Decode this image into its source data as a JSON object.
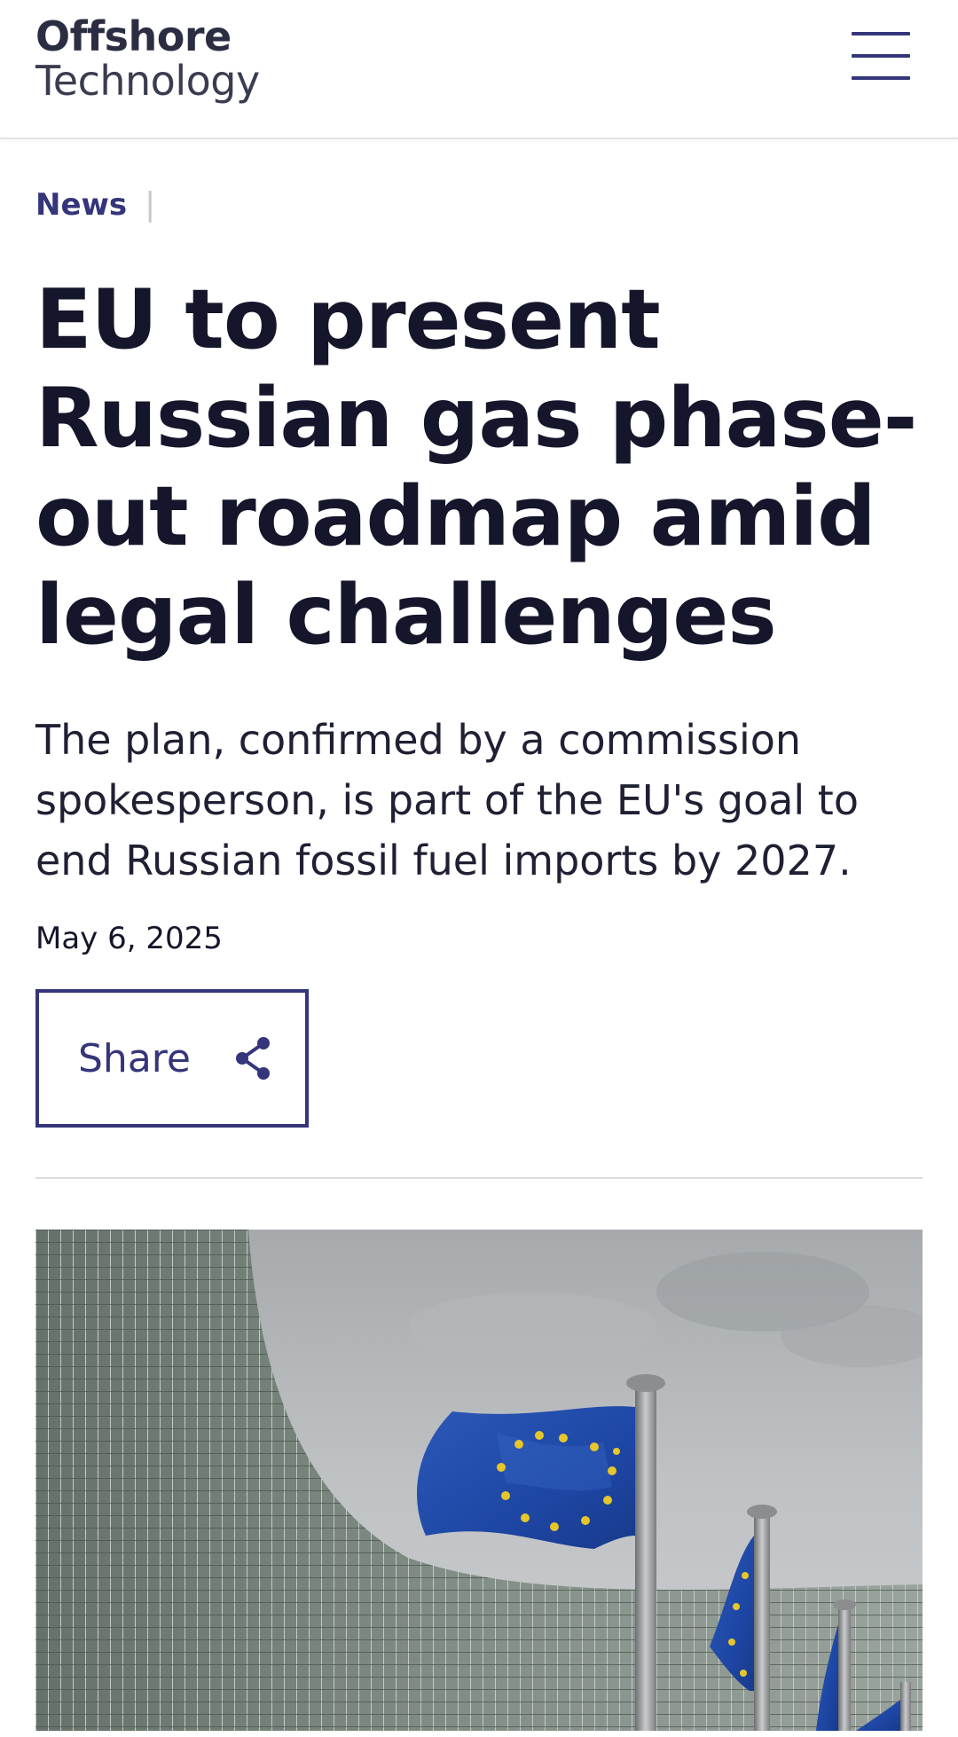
{
  "header": {
    "logo_line1": "Offshore",
    "logo_line2": "Technology",
    "menu_icon": "hamburger-menu-icon"
  },
  "breadcrumb": {
    "category": "News",
    "separator": "|"
  },
  "article": {
    "title": "EU to present Russian gas phase-out roadmap amid legal challenges",
    "standfirst": "The plan, confirmed by a commission spokesperson, is part of the EU's goal to end Russian fossil fuel imports by 2027.",
    "date": "May 6, 2025",
    "share_label": "Share",
    "share_icon": "share-icon"
  },
  "colors": {
    "brand": "#34357a",
    "text": "#15162b",
    "divider": "#dcdcdc"
  }
}
